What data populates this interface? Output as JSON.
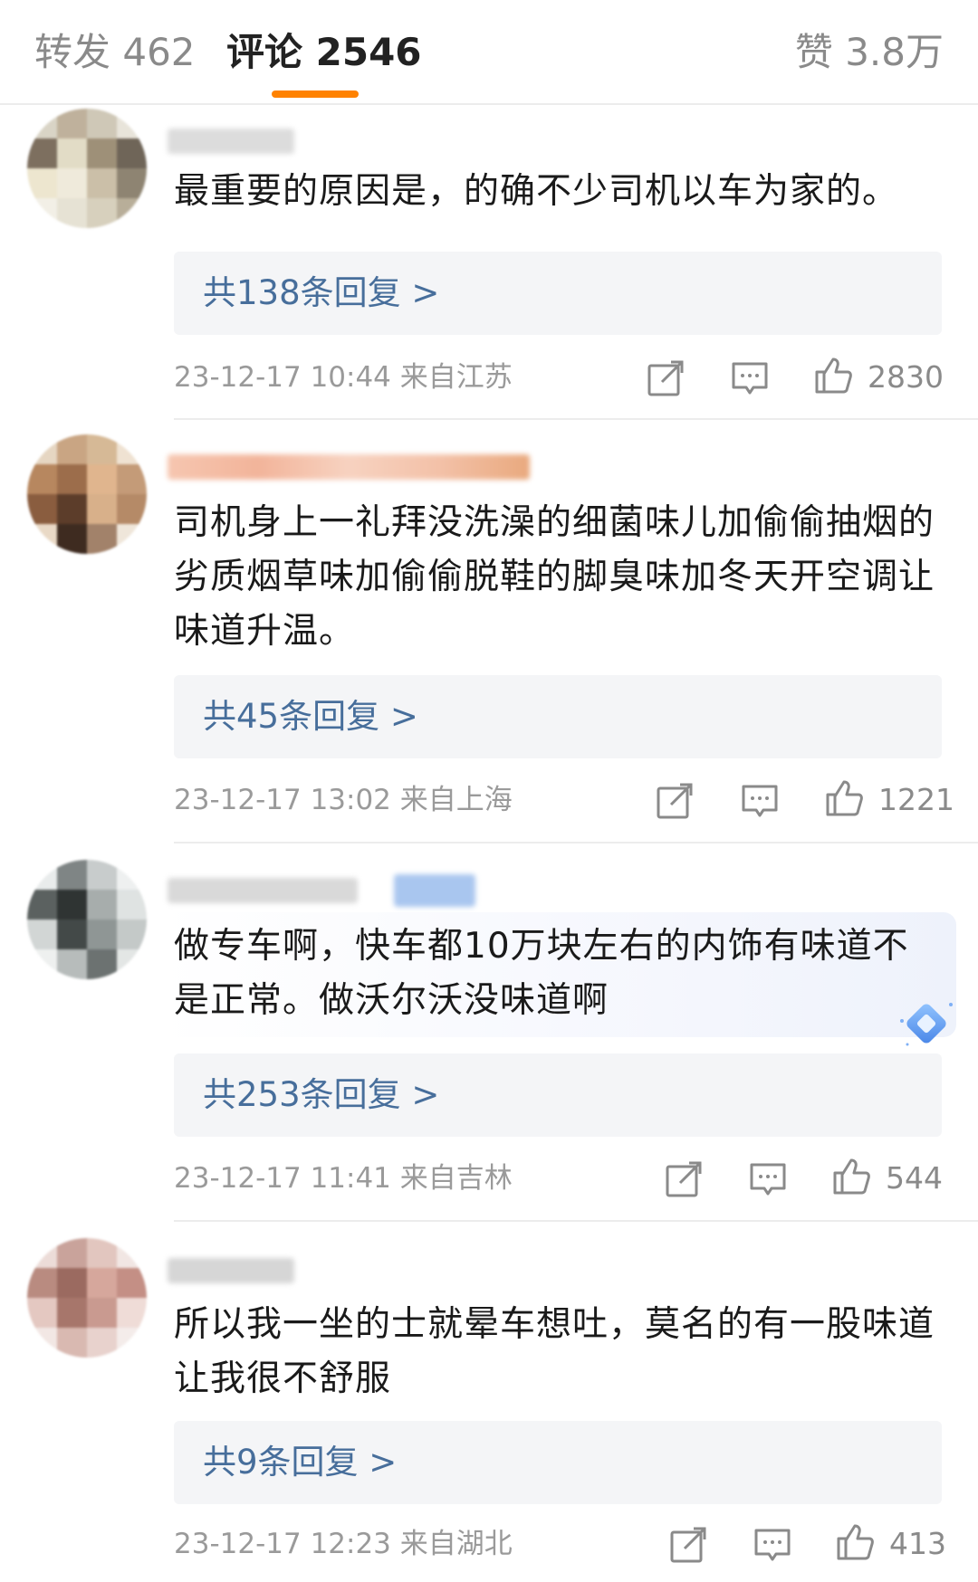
{
  "tabs": {
    "repost": "转发 462",
    "comments": "评论 2546",
    "likes": "赞 3.8万"
  },
  "comments": [
    {
      "text": "最重要的原因是，的确不少司机以车为家的。",
      "replies": "共138条回复 >",
      "time_location": "23-12-17 10:44 来自江苏",
      "likes": "2830"
    },
    {
      "text": "司机身上一礼拜没洗澡的细菌味儿加偷偷抽烟的劣质烟草味加偷偷脱鞋的脚臭味加冬天开空调让味道升温。",
      "replies": "共45条回复 >",
      "time_location": "23-12-17 13:02 来自上海",
      "likes": "1221"
    },
    {
      "text": "做专车啊，快车都10万块左右的内饰有味道不是正常。做沃尔沃没味道啊",
      "replies": "共253条回复 >",
      "time_location": "23-12-17 11:41 来自吉林",
      "likes": "544"
    },
    {
      "text": "所以我一坐的士就晕车想吐，莫名的有一股味道让我很不舒服",
      "replies": "共9条回复 >",
      "time_location": "23-12-17 12:23 来自湖北",
      "likes": "413"
    }
  ],
  "icons": [
    "share-icon",
    "comment-icon",
    "thumbs-up-icon",
    "diamond-badge-icon"
  ],
  "colors": {
    "accent": "#ff8200",
    "reply_link": "#476e9b",
    "meta_text": "#9a9a9a"
  }
}
